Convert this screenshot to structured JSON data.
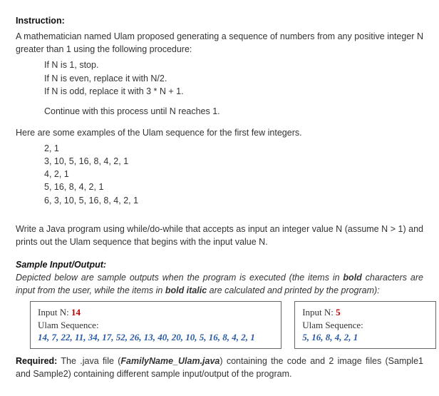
{
  "labels": {
    "instruction": "Instruction:",
    "sample_io": "Sample Input/Output:",
    "required": "Required:"
  },
  "intro": "A mathematician named Ulam proposed generating a sequence of numbers from any positive integer N greater than 1 using the following procedure:",
  "rules": {
    "r1": "If N is 1, stop.",
    "r2": "If N is even, replace it with N/2.",
    "r3": "If N is odd, replace it with 3 * N + 1.",
    "cont": "Continue with this process until N reaches 1."
  },
  "examples_intro": "Here are some examples of the Ulam sequence for the first few integers.",
  "examples": {
    "e1": "2, 1",
    "e2": "3, 10, 5, 16, 8, 4, 2, 1",
    "e3": "4, 2, 1",
    "e4": "5, 16, 8, 4, 2, 1",
    "e5": "6, 3, 10, 5, 16, 8, 4, 2, 1"
  },
  "task": "Write a Java program using while/do-while that accepts as input an integer value N (assume N > 1) and prints out the Ulam sequence that begins with the input value N.",
  "sample_desc_a": "Depicted below are sample outputs when the program is executed (the items in ",
  "sample_desc_b": "bold",
  "sample_desc_c": " characters are input from the user, while the items in ",
  "sample_desc_d": "bold italic",
  "sample_desc_e": " are calculated and printed by the program):",
  "box": {
    "prompt": "Input N:  ",
    "label": "Ulam Sequence:",
    "s1": {
      "n": "14",
      "seq": "14, 7, 22, 11, 34, 17, 52, 26, 13, 40, 20, 10, 5, 16, 8, 4, 2, 1"
    },
    "s2": {
      "n": "5",
      "seq": "5, 16, 8, 4, 2, 1"
    }
  },
  "req_a": " The .java file (",
  "req_b": "FamilyName_Ulam.java",
  "req_c": ") containing the code and 2 image files (Sample1 and Sample2) containing different sample input/output of the program."
}
